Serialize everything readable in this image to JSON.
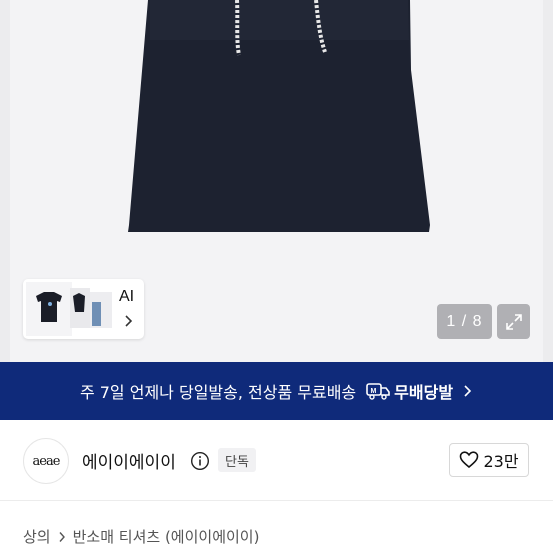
{
  "gallery": {
    "thumb_label": "AI",
    "counter": "1 / 8"
  },
  "banner": {
    "text": "주 7일 언제나 당일발송, 전상품 무료배송",
    "badge_label": "무배당발",
    "accent_color": "#0f2a7a"
  },
  "brand": {
    "logo_text": "aeae",
    "name": "에이이에이이",
    "badge": "단독",
    "likes": "23만"
  },
  "breadcrumb": {
    "category": "상의",
    "subcategory": "반소매 티셔츠 (에이이에이이)"
  }
}
